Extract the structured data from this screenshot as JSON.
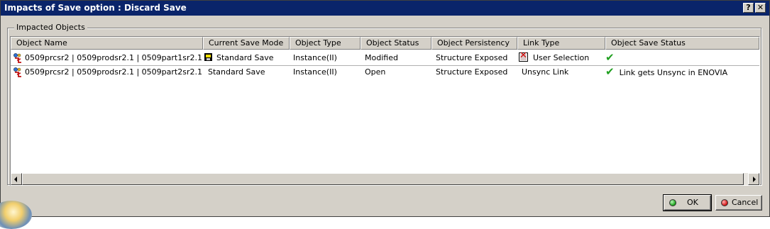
{
  "window": {
    "title": "Impacts of Save option : Discard Save",
    "help_label": "?",
    "close_label": "✕"
  },
  "group": {
    "label": "Impacted Objects"
  },
  "table": {
    "columns": [
      "Object Name",
      "Current Save Mode",
      "Object Type",
      "Object Status",
      "Object Persistency",
      "Link Type",
      "Object Save Status"
    ],
    "rows": [
      {
        "object_name": "0509prcsr2 | 0509prodsr2.1 | 0509part1sr2.1",
        "current_save_mode": "Standard Save",
        "save_mode_icon": "floppy-disk-icon",
        "object_type": "Instance(II)",
        "object_status": "Modified",
        "object_persistency": "Structure Exposed",
        "link_type": "User Selection",
        "link_type_icon": "red-x-link-icon",
        "object_save_status": "",
        "status_icon": "green-check-icon"
      },
      {
        "object_name": "0509prcsr2 | 0509prodsr2.1 | 0509part2sr2.1",
        "current_save_mode": "Standard Save",
        "object_type": "Instance(II)",
        "object_status": "Open",
        "object_persistency": "Structure Exposed",
        "link_type": "Unsync Link",
        "object_save_status": "Link gets Unsync in ENOVIA",
        "status_icon": "green-check-icon"
      }
    ]
  },
  "buttons": {
    "ok_label": "OK",
    "cancel_label": "Cancel"
  },
  "colors": {
    "titlebar": "#0a246a",
    "check": "#1f9f1f",
    "ok_dot": "#16a016",
    "cancel_dot": "#d01010"
  }
}
